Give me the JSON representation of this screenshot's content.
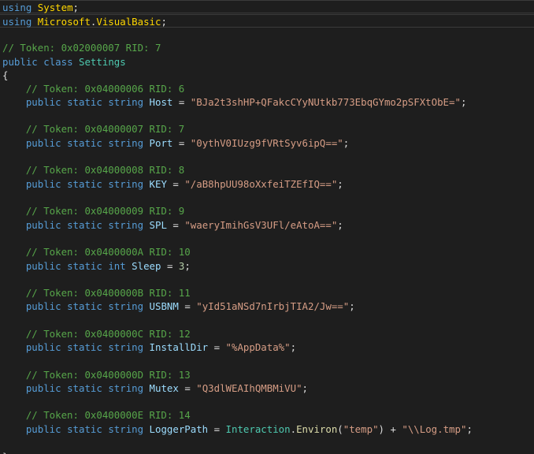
{
  "lines": [
    {
      "tokens": [
        {
          "t": "using",
          "c": "kw"
        },
        {
          "t": " ",
          "c": "pun"
        },
        {
          "t": "System",
          "c": "ns"
        },
        {
          "t": ";",
          "c": "pun"
        }
      ]
    },
    {
      "tokens": [
        {
          "t": "using",
          "c": "kw"
        },
        {
          "t": " ",
          "c": "pun"
        },
        {
          "t": "Microsoft",
          "c": "ns"
        },
        {
          "t": ".",
          "c": "pun"
        },
        {
          "t": "VisualBasic",
          "c": "ns"
        },
        {
          "t": ";",
          "c": "pun"
        }
      ]
    },
    {
      "tokens": []
    },
    {
      "tokens": [
        {
          "t": "// Token: 0x02000007 RID: 7",
          "c": "cm"
        }
      ]
    },
    {
      "tokens": [
        {
          "t": "public",
          "c": "kw"
        },
        {
          "t": " ",
          "c": "pun"
        },
        {
          "t": "class",
          "c": "kw"
        },
        {
          "t": " ",
          "c": "pun"
        },
        {
          "t": "Settings",
          "c": "ty"
        }
      ]
    },
    {
      "tokens": [
        {
          "t": "{",
          "c": "pun"
        }
      ]
    },
    {
      "tokens": [
        {
          "t": "    ",
          "c": "pun"
        },
        {
          "t": "// Token: 0x04000006 RID: 6",
          "c": "cm"
        }
      ]
    },
    {
      "tokens": [
        {
          "t": "    ",
          "c": "pun"
        },
        {
          "t": "public",
          "c": "kw"
        },
        {
          "t": " ",
          "c": "pun"
        },
        {
          "t": "static",
          "c": "kw"
        },
        {
          "t": " ",
          "c": "pun"
        },
        {
          "t": "string",
          "c": "kw"
        },
        {
          "t": " ",
          "c": "pun"
        },
        {
          "t": "Host",
          "c": "id"
        },
        {
          "t": " = ",
          "c": "pun"
        },
        {
          "t": "\"BJa2t3shHP+QFakcCYyNUtkb773EbqGYmo2pSFXtObE=\"",
          "c": "str"
        },
        {
          "t": ";",
          "c": "pun"
        }
      ]
    },
    {
      "tokens": []
    },
    {
      "tokens": [
        {
          "t": "    ",
          "c": "pun"
        },
        {
          "t": "// Token: 0x04000007 RID: 7",
          "c": "cm"
        }
      ]
    },
    {
      "tokens": [
        {
          "t": "    ",
          "c": "pun"
        },
        {
          "t": "public",
          "c": "kw"
        },
        {
          "t": " ",
          "c": "pun"
        },
        {
          "t": "static",
          "c": "kw"
        },
        {
          "t": " ",
          "c": "pun"
        },
        {
          "t": "string",
          "c": "kw"
        },
        {
          "t": " ",
          "c": "pun"
        },
        {
          "t": "Port",
          "c": "id"
        },
        {
          "t": " = ",
          "c": "pun"
        },
        {
          "t": "\"0ythV0IUzg9fVRtSyv6ipQ==\"",
          "c": "str"
        },
        {
          "t": ";",
          "c": "pun"
        }
      ]
    },
    {
      "tokens": []
    },
    {
      "tokens": [
        {
          "t": "    ",
          "c": "pun"
        },
        {
          "t": "// Token: 0x04000008 RID: 8",
          "c": "cm"
        }
      ]
    },
    {
      "tokens": [
        {
          "t": "    ",
          "c": "pun"
        },
        {
          "t": "public",
          "c": "kw"
        },
        {
          "t": " ",
          "c": "pun"
        },
        {
          "t": "static",
          "c": "kw"
        },
        {
          "t": " ",
          "c": "pun"
        },
        {
          "t": "string",
          "c": "kw"
        },
        {
          "t": " ",
          "c": "pun"
        },
        {
          "t": "KEY",
          "c": "id"
        },
        {
          "t": " = ",
          "c": "pun"
        },
        {
          "t": "\"/aB8hpUU98oXxfeiTZEfIQ==\"",
          "c": "str"
        },
        {
          "t": ";",
          "c": "pun"
        }
      ]
    },
    {
      "tokens": []
    },
    {
      "tokens": [
        {
          "t": "    ",
          "c": "pun"
        },
        {
          "t": "// Token: 0x04000009 RID: 9",
          "c": "cm"
        }
      ]
    },
    {
      "tokens": [
        {
          "t": "    ",
          "c": "pun"
        },
        {
          "t": "public",
          "c": "kw"
        },
        {
          "t": " ",
          "c": "pun"
        },
        {
          "t": "static",
          "c": "kw"
        },
        {
          "t": " ",
          "c": "pun"
        },
        {
          "t": "string",
          "c": "kw"
        },
        {
          "t": " ",
          "c": "pun"
        },
        {
          "t": "SPL",
          "c": "id"
        },
        {
          "t": " = ",
          "c": "pun"
        },
        {
          "t": "\"waeryImihGsV3UFl/eAtoA==\"",
          "c": "str"
        },
        {
          "t": ";",
          "c": "pun"
        }
      ]
    },
    {
      "tokens": []
    },
    {
      "tokens": [
        {
          "t": "    ",
          "c": "pun"
        },
        {
          "t": "// Token: 0x0400000A RID: 10",
          "c": "cm"
        }
      ]
    },
    {
      "tokens": [
        {
          "t": "    ",
          "c": "pun"
        },
        {
          "t": "public",
          "c": "kw"
        },
        {
          "t": " ",
          "c": "pun"
        },
        {
          "t": "static",
          "c": "kw"
        },
        {
          "t": " ",
          "c": "pun"
        },
        {
          "t": "int",
          "c": "kw"
        },
        {
          "t": " ",
          "c": "pun"
        },
        {
          "t": "Sleep",
          "c": "id"
        },
        {
          "t": " = ",
          "c": "pun"
        },
        {
          "t": "3",
          "c": "num"
        },
        {
          "t": ";",
          "c": "pun"
        }
      ]
    },
    {
      "tokens": []
    },
    {
      "tokens": [
        {
          "t": "    ",
          "c": "pun"
        },
        {
          "t": "// Token: 0x0400000B RID: 11",
          "c": "cm"
        }
      ]
    },
    {
      "tokens": [
        {
          "t": "    ",
          "c": "pun"
        },
        {
          "t": "public",
          "c": "kw"
        },
        {
          "t": " ",
          "c": "pun"
        },
        {
          "t": "static",
          "c": "kw"
        },
        {
          "t": " ",
          "c": "pun"
        },
        {
          "t": "string",
          "c": "kw"
        },
        {
          "t": " ",
          "c": "pun"
        },
        {
          "t": "USBNM",
          "c": "id"
        },
        {
          "t": " = ",
          "c": "pun"
        },
        {
          "t": "\"yId51aNSd7nIrbjTIA2/Jw==\"",
          "c": "str"
        },
        {
          "t": ";",
          "c": "pun"
        }
      ]
    },
    {
      "tokens": []
    },
    {
      "tokens": [
        {
          "t": "    ",
          "c": "pun"
        },
        {
          "t": "// Token: 0x0400000C RID: 12",
          "c": "cm"
        }
      ]
    },
    {
      "tokens": [
        {
          "t": "    ",
          "c": "pun"
        },
        {
          "t": "public",
          "c": "kw"
        },
        {
          "t": " ",
          "c": "pun"
        },
        {
          "t": "static",
          "c": "kw"
        },
        {
          "t": " ",
          "c": "pun"
        },
        {
          "t": "string",
          "c": "kw"
        },
        {
          "t": " ",
          "c": "pun"
        },
        {
          "t": "InstallDir",
          "c": "id"
        },
        {
          "t": " = ",
          "c": "pun"
        },
        {
          "t": "\"%AppData%\"",
          "c": "str"
        },
        {
          "t": ";",
          "c": "pun"
        }
      ]
    },
    {
      "tokens": []
    },
    {
      "tokens": [
        {
          "t": "    ",
          "c": "pun"
        },
        {
          "t": "// Token: 0x0400000D RID: 13",
          "c": "cm"
        }
      ]
    },
    {
      "tokens": [
        {
          "t": "    ",
          "c": "pun"
        },
        {
          "t": "public",
          "c": "kw"
        },
        {
          "t": " ",
          "c": "pun"
        },
        {
          "t": "static",
          "c": "kw"
        },
        {
          "t": " ",
          "c": "pun"
        },
        {
          "t": "string",
          "c": "kw"
        },
        {
          "t": " ",
          "c": "pun"
        },
        {
          "t": "Mutex",
          "c": "id"
        },
        {
          "t": " = ",
          "c": "pun"
        },
        {
          "t": "\"Q3dlWEAIhQMBMiVU\"",
          "c": "str"
        },
        {
          "t": ";",
          "c": "pun"
        }
      ]
    },
    {
      "tokens": []
    },
    {
      "tokens": [
        {
          "t": "    ",
          "c": "pun"
        },
        {
          "t": "// Token: 0x0400000E RID: 14",
          "c": "cm"
        }
      ]
    },
    {
      "tokens": [
        {
          "t": "    ",
          "c": "pun"
        },
        {
          "t": "public",
          "c": "kw"
        },
        {
          "t": " ",
          "c": "pun"
        },
        {
          "t": "static",
          "c": "kw"
        },
        {
          "t": " ",
          "c": "pun"
        },
        {
          "t": "string",
          "c": "kw"
        },
        {
          "t": " ",
          "c": "pun"
        },
        {
          "t": "LoggerPath",
          "c": "id"
        },
        {
          "t": " = ",
          "c": "pun"
        },
        {
          "t": "Interaction",
          "c": "ty"
        },
        {
          "t": ".",
          "c": "pun"
        },
        {
          "t": "Environ",
          "c": "meth"
        },
        {
          "t": "(",
          "c": "pun"
        },
        {
          "t": "\"temp\"",
          "c": "str"
        },
        {
          "t": ") + ",
          "c": "pun"
        },
        {
          "t": "\"\\\\Log.tmp\"",
          "c": "str"
        },
        {
          "t": ";",
          "c": "pun"
        }
      ]
    },
    {
      "tokens": []
    },
    {
      "tokens": [
        {
          "t": "}",
          "c": "pun"
        }
      ]
    }
  ]
}
